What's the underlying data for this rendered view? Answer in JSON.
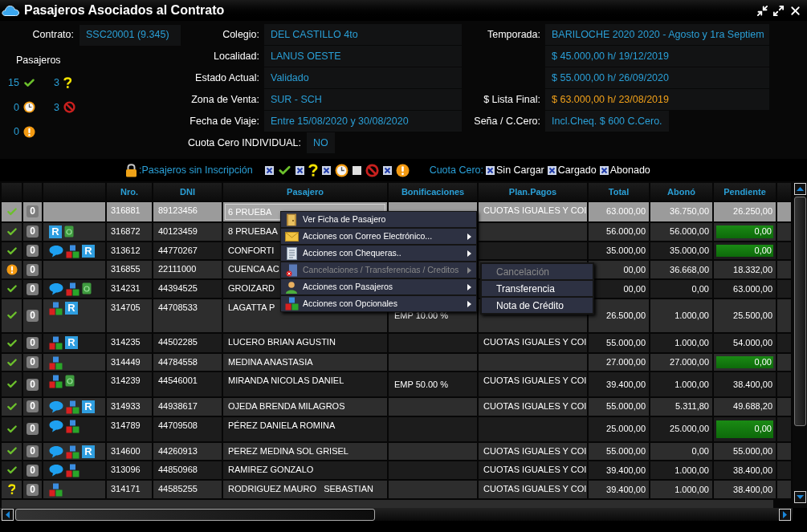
{
  "window": {
    "title": "Pasajeros Asociados al Contrato"
  },
  "contract": {
    "label": "Contrato:",
    "value": "SSC20001 (9.345)"
  },
  "passenger_counts": {
    "title": "Pasajeros",
    "items": [
      {
        "count": "15",
        "kind": "ok"
      },
      {
        "count": "3",
        "kind": "question"
      },
      {
        "count": "0",
        "kind": "clock"
      },
      {
        "count": "3",
        "kind": "forbidden"
      },
      {
        "count": "0",
        "kind": "warning"
      }
    ]
  },
  "details": [
    {
      "label": "Colegio:",
      "value": "DEL CASTILLO 4to"
    },
    {
      "label": "Localidad:",
      "value": "LANUS OESTE"
    },
    {
      "label": "Estado Actual:",
      "value": "Validado"
    },
    {
      "label": "Zona de Venta:",
      "value": "SUR - SCH"
    },
    {
      "label": "Fecha de Viaje:",
      "value": "Entre 15/08/2020 y 30/08/2020"
    }
  ],
  "individual_zero_fee": {
    "label": "Cuota Cero INDIVIDUAL:",
    "value": "NO"
  },
  "season": [
    {
      "label": "Temporada:",
      "value": "BARILOCHE 2020 2020 - Agosto y 1ra Septiem",
      "highlight": false
    },
    {
      "value": "$ 45.000,00 h/ 19/12/2019",
      "highlight": false
    },
    {
      "value": "$ 55.000,00 h/ 26/09/2020",
      "highlight": false
    },
    {
      "label": "$ Lista Final:",
      "value": "$ 63.000,00 h/ 23/08/2019",
      "highlight": true
    },
    {
      "label": "Seña / C.Cero:",
      "value": "Incl.Cheq. $ 600 C.Cero.",
      "highlight": false
    }
  ],
  "legend": {
    "label": ":Pasajeros sin Inscripción",
    "status_filters": [
      {
        "kind": "ok",
        "checked": true
      },
      {
        "kind": "question",
        "checked": true
      },
      {
        "kind": "clock",
        "checked": true
      },
      {
        "kind": "forbidden",
        "checked": false
      },
      {
        "kind": "warning",
        "checked": true
      }
    ],
    "zero_fee_label": "Cuota Cero:",
    "zero_fee_filters": [
      {
        "label": "Sin Cargar",
        "checked": true
      },
      {
        "label": "Cargado",
        "checked": true
      },
      {
        "label": "Abonado",
        "checked": true
      }
    ]
  },
  "table": {
    "columns": [
      "Nro.",
      "DNI",
      "Pasajero",
      "Bonificaciones",
      "Plan.Pagos",
      "Total",
      "Abonó",
      "Pendiente"
    ],
    "rows": [
      {
        "selected": true,
        "kind": "ok",
        "count": "0",
        "icons": [],
        "nro": "316881",
        "dni": "89123456",
        "pasajero": "6 PRUEBA",
        "plan": "CUOTAS IGUALES Y COI",
        "total": "63.000,00",
        "abono": "36.750,00",
        "pendiente": "26.250,00",
        "settled": false
      },
      {
        "selected": false,
        "kind": "ok",
        "count": "0",
        "icons": [
          {
            "kind": "letter",
            "text": "R"
          },
          {
            "kind": "device"
          }
        ],
        "nro": "316872",
        "dni": "40123459",
        "pasajero": "8 PRUEBAA",
        "total": "56.000,00",
        "abono": "56.000,00",
        "pendiente": "0,00",
        "settled": true
      },
      {
        "selected": false,
        "kind": "ok",
        "count": "0",
        "icons": [
          {
            "kind": "chat"
          },
          {
            "kind": "blocks"
          },
          {
            "kind": "letter",
            "text": "R"
          }
        ],
        "nro": "313612",
        "dni": "44770267",
        "pasajero": "CONFORTI",
        "total": "35.000,00",
        "abono": "35.000,00",
        "pendiente": "0,00",
        "settled": true
      },
      {
        "selected": false,
        "kind": "warning",
        "count": "0",
        "icons": [],
        "nro": "316855",
        "dni": "22111000",
        "pasajero": "CUENCA AC",
        "total": "00,00",
        "abono": "36.668,00",
        "pendiente": "18.332,00",
        "settled": false
      },
      {
        "selected": false,
        "kind": "ok",
        "count": "0",
        "icons": [
          {
            "kind": "chat"
          },
          {
            "kind": "blocks"
          },
          {
            "kind": "device"
          }
        ],
        "nro": "314231",
        "dni": "44394525",
        "pasajero": "GROIZARD",
        "total": "00,00",
        "abono": "0,00",
        "pendiente": "63.000,00",
        "settled": false
      },
      {
        "selected": false,
        "kind": "ok",
        "count": "0",
        "icons": [
          {
            "kind": "blocks"
          },
          {
            "kind": "letter",
            "text": "R"
          }
        ],
        "nro": "314705",
        "dni": "44708533",
        "pasajero": "LAGATTA P",
        "bonif": "EMP 10.00 %",
        "total": "26.500,00",
        "abono": "1.000,00",
        "pendiente": "25.500,00",
        "settled": false
      },
      {
        "selected": false,
        "kind": "ok",
        "count": "0",
        "icons": [
          {
            "kind": "blocks"
          },
          {
            "kind": "letter",
            "text": "R"
          }
        ],
        "nro": "314235",
        "dni": "44502285",
        "pasajero": "LUCERO BRIAN AGUSTIN",
        "plan": "CUOTAS IGUALES Y COI",
        "total": "55.000,00",
        "abono": "1.000,00",
        "pendiente": "54.000,00",
        "settled": false
      },
      {
        "selected": false,
        "kind": "ok",
        "count": "0",
        "icons": [
          {
            "kind": "blocks"
          }
        ],
        "nro": "314449",
        "dni": "44784558",
        "pasajero": "MEDINA ANASTASIA",
        "total": "27.000,00",
        "abono": "27.000,00",
        "pendiente": "0,00",
        "settled": true
      },
      {
        "selected": false,
        "kind": "ok",
        "count": "0",
        "icons": [
          {
            "kind": "blocks"
          },
          {
            "kind": "device"
          }
        ],
        "nro": "314239",
        "dni": "44546001",
        "pasajero": "MIRANDA NICOLAS DANIEL",
        "bonif": "EMP 50.00 %",
        "plan": "CUOTAS IGUALES Y COI",
        "total": "39.400,00",
        "abono": "1.000,00",
        "pendiente": "38.400,00",
        "settled": false
      },
      {
        "selected": false,
        "kind": "ok",
        "count": "0",
        "icons": [
          {
            "kind": "chat"
          },
          {
            "kind": "blocks"
          },
          {
            "kind": "letter",
            "text": "R"
          }
        ],
        "nro": "314933",
        "dni": "44938617",
        "pasajero": "OJEDA BRENDA MILAGROS",
        "plan": "CUOTAS IGUALES Y COI",
        "total": "55.000,00",
        "abono": "5.311,80",
        "pendiente": "49.688,20",
        "settled": false
      },
      {
        "selected": false,
        "kind": "ok",
        "count": "0",
        "icons": [
          {
            "kind": "chat"
          },
          {
            "kind": "blocks"
          }
        ],
        "nro": "314789",
        "dni": "44709508",
        "pasajero": "PÉREZ DANIELA ROMINA",
        "total": "25.000,00",
        "abono": "25.000,00",
        "pendiente": "0,00",
        "settled": true
      },
      {
        "selected": false,
        "kind": "ok",
        "count": "0",
        "icons": [
          {
            "kind": "chat"
          },
          {
            "kind": "blocks"
          },
          {
            "kind": "letter",
            "text": "R"
          }
        ],
        "nro": "314600",
        "dni": "44260913",
        "pasajero": "PEREZ MEDINA SOL GRISEL",
        "plan": "CUOTAS IGUALES Y COI",
        "total": "55.000,00",
        "abono": "0,00",
        "pendiente": "55.000,00",
        "settled": false
      },
      {
        "selected": false,
        "kind": "ok",
        "count": "0",
        "icons": [
          {
            "kind": "chat"
          },
          {
            "kind": "blocks"
          }
        ],
        "nro": "313096",
        "dni": "44850968",
        "pasajero": "RAMIREZ GONZALO",
        "plan": "CUOTAS IGUALES Y COI",
        "total": "39.400,00",
        "abono": "1.000,00",
        "pendiente": "38.400,00",
        "settled": false
      },
      {
        "selected": false,
        "kind": "question",
        "count": "0",
        "icons": [
          {
            "kind": "blocks"
          }
        ],
        "nro": "314171",
        "dni": "44585255",
        "pasajero": "RODRIGUEZ MAURO   SEBASTIAN",
        "plan": "CUOTAS IGUALES Y COI",
        "total": "39.400,00",
        "abono": "1.000,00",
        "pendiente": "38.400,00",
        "settled": false
      }
    ]
  },
  "context_menu": {
    "items": [
      {
        "kind": "door",
        "label": "Ver Ficha de Pasajero",
        "submenu": false,
        "disabled": false
      },
      {
        "kind": "envelope",
        "label": "Acciones con Correo Electrónico...",
        "submenu": true,
        "disabled": false
      },
      {
        "kind": "document",
        "label": "Acciones con Chequeras..",
        "submenu": true,
        "disabled": false
      },
      {
        "kind": "door-cancel",
        "label": "Cancelaciones / Transferencias / Creditos",
        "submenu": true,
        "disabled": true
      },
      {
        "kind": "person",
        "label": "Acciones con Pasajeros",
        "submenu": true,
        "disabled": false
      },
      {
        "kind": "blocks",
        "label": "Acciones con Opcionales",
        "submenu": true,
        "disabled": false
      }
    ],
    "submenu": [
      {
        "label": "Cancelación",
        "disabled": true
      },
      {
        "label": "Transferencia",
        "disabled": false
      },
      {
        "label": "Nota de Crédito",
        "disabled": false
      }
    ]
  }
}
